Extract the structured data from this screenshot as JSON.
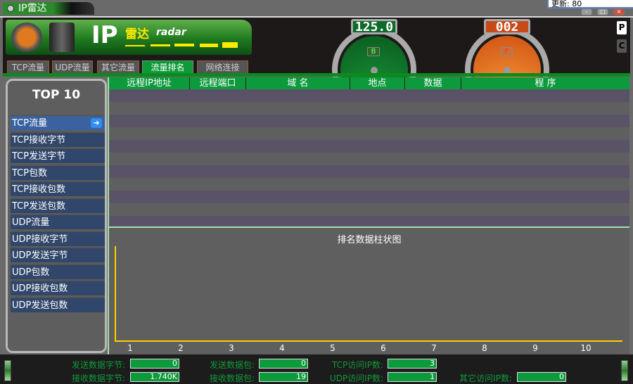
{
  "window": {
    "title": "IP雷达",
    "update_text": "更新: 80",
    "minimize": "–",
    "maximize": "□",
    "close": "×"
  },
  "logo": {
    "ip": "IP",
    "brand": "雷达",
    "radar": "radar"
  },
  "tabs": [
    {
      "label": "TCP流量"
    },
    {
      "label": "UDP流量"
    },
    {
      "label": "其它流量"
    },
    {
      "label": "流量排名",
      "active": true
    },
    {
      "label": "网络连接"
    }
  ],
  "gauges": [
    {
      "value": "125.0",
      "letter": "B",
      "color": "#0c7a2e"
    },
    {
      "value": "002",
      "letter": "P",
      "color": "#e05a18"
    }
  ],
  "side_buttons": [
    "P",
    "C"
  ],
  "sidebar": {
    "title": "TOP 10",
    "arrow": "➜",
    "items": [
      "TCP流量",
      "TCP接收字节",
      "TCP发送字节",
      "TCP包数",
      "TCP接收包数",
      "TCP发送包数",
      "UDP流量",
      "UDP接收字节",
      "UDP发送字节",
      "UDP包数",
      "UDP接收包数",
      "UDP发送包数"
    ],
    "selected": 0
  },
  "table": {
    "columns": [
      "远程IP地址",
      "远程端口",
      "域 名",
      "地点",
      "数据",
      "程 序"
    ],
    "rows": []
  },
  "chart_data": {
    "type": "bar",
    "title": "排名数据柱状图",
    "categories": [
      "1",
      "2",
      "3",
      "4",
      "5",
      "6",
      "7",
      "8",
      "9",
      "10"
    ],
    "values": [],
    "xlabel": "",
    "ylabel": ""
  },
  "status": {
    "send_bytes_label": "发送数据字节:",
    "send_bytes": "0",
    "recv_bytes_label": "接收数据字节:",
    "recv_bytes": "1.740K",
    "send_packets_label": "发送数据包:",
    "send_packets": "0",
    "recv_packets_label": "接收数据包:",
    "recv_packets": "19",
    "tcp_ip_label": "TCP访问IP数:",
    "tcp_ip": "3",
    "udp_ip_label": "UDP访问IP数:",
    "udp_ip": "1",
    "other_ip_label": "其它访问IP数:",
    "other_ip": "0"
  }
}
